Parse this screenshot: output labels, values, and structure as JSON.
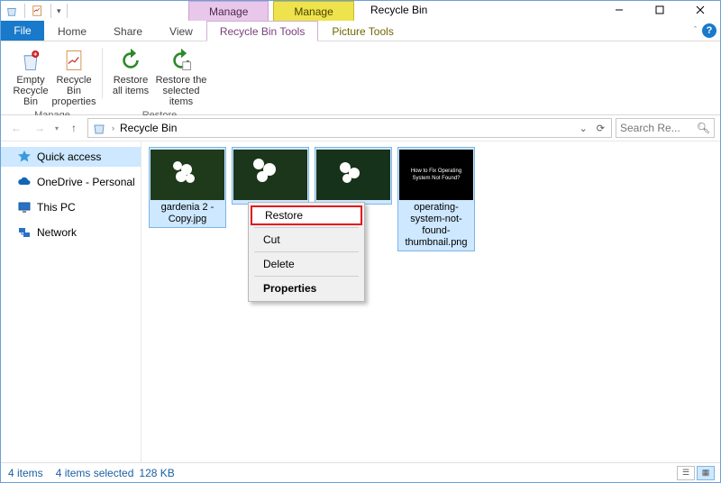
{
  "window": {
    "title": "Recycle Bin",
    "manage_tab_1": "Manage",
    "manage_tab_2": "Manage"
  },
  "tabs": {
    "file": "File",
    "home": "Home",
    "share": "Share",
    "view": "View",
    "recycle_tools": "Recycle Bin Tools",
    "picture_tools": "Picture Tools"
  },
  "ribbon": {
    "empty": "Empty Recycle Bin",
    "props": "Recycle Bin properties",
    "restore_all": "Restore all items",
    "restore_sel": "Restore the selected items",
    "grp_manage": "Manage",
    "grp_restore": "Restore"
  },
  "address": {
    "location": "Recycle Bin",
    "search_placeholder": "Search Re..."
  },
  "nav": {
    "quick": "Quick access",
    "onedrive": "OneDrive - Personal",
    "thispc": "This PC",
    "network": "Network"
  },
  "files": [
    {
      "name": "gardenia 2 - Copy.jpg",
      "kind": "flower"
    },
    {
      "name": "",
      "kind": "flower"
    },
    {
      "name": "",
      "kind": "flower"
    },
    {
      "name": "operating-system-not-found-thumbnail.png",
      "kind": "dark",
      "thumb_text": "How to Fix Operating System Not Found?"
    }
  ],
  "context_menu": {
    "restore": "Restore",
    "cut": "Cut",
    "delete": "Delete",
    "properties": "Properties"
  },
  "status": {
    "count": "4 items",
    "selected": "4 items selected",
    "size": "128 KB"
  }
}
